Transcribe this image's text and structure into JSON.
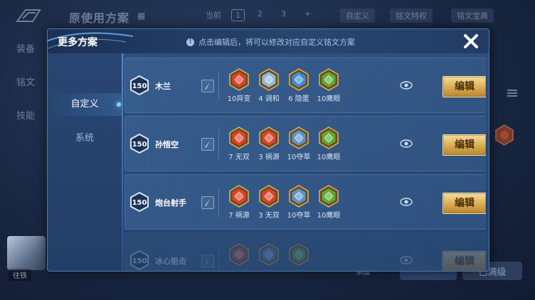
{
  "background": {
    "title": "原使用方案",
    "tab_current": "当前",
    "tabs": [
      "1",
      "2",
      "3",
      "+"
    ],
    "custom_chip": "自定义",
    "rune_special_chip": "铭文特权",
    "rune_dict_chip": "铭文宝典",
    "left_menu": [
      "装备",
      "铭文",
      "技能"
    ],
    "avatar_tag": "往铁",
    "bottom_buttons": [
      "已满级"
    ],
    "bottom_small": "添加"
  },
  "modal": {
    "title": "更多方案",
    "hint": "点击编辑后，将可以修改对应自定义铭文方案",
    "sidebar_tabs": [
      {
        "label": "自定义",
        "active": true
      },
      {
        "label": "系统",
        "active": false
      }
    ],
    "rows": [
      {
        "level": "150",
        "name": "木兰",
        "runes": [
          {
            "label": "10异变",
            "color": "#d9442a",
            "icon": "red-rune-icon"
          },
          {
            "label": "4 调和",
            "color": "#8fb8d8",
            "icon": "blue-rune-icon"
          },
          {
            "label": "6 隐匿",
            "color": "#3a8ed8",
            "icon": "blue-rune-icon"
          },
          {
            "label": "10鹰眼",
            "color": "#5fa832",
            "icon": "green-rune-icon"
          }
        ],
        "edit_label": "编辑"
      },
      {
        "level": "150",
        "name": "孙悟空",
        "runes": [
          {
            "label": "7 无双",
            "color": "#d9442a",
            "icon": "red-rune-icon"
          },
          {
            "label": "3 祸源",
            "color": "#d9442a",
            "icon": "red-rune-icon"
          },
          {
            "label": "10夺萃",
            "color": "#5b92c8",
            "icon": "blue-rune-icon"
          },
          {
            "label": "10鹰眼",
            "color": "#5fa832",
            "icon": "green-rune-icon"
          }
        ],
        "edit_label": "编辑"
      },
      {
        "level": "150",
        "name": "炮台射手",
        "runes": [
          {
            "label": "7 祸源",
            "color": "#d9442a",
            "icon": "red-rune-icon"
          },
          {
            "label": "3 无双",
            "color": "#d9442a",
            "icon": "red-rune-icon"
          },
          {
            "label": "10夺萃",
            "color": "#5b92c8",
            "icon": "blue-rune-icon"
          },
          {
            "label": "10鹰眼",
            "color": "#5fa832",
            "icon": "green-rune-icon"
          }
        ],
        "edit_label": "编辑"
      },
      {
        "level": "150",
        "name": "冰心狙击",
        "runes": [
          {
            "label": "",
            "color": "#d9442a",
            "icon": "red-rune-icon"
          },
          {
            "label": "",
            "color": "#5b92c8",
            "icon": "blue-rune-icon"
          },
          {
            "label": "",
            "color": "#5fa832",
            "icon": "green-rune-icon"
          }
        ],
        "edit_label": "编辑"
      }
    ]
  },
  "colors": {
    "accent_gold": "#d9ab52",
    "modal_bg": "#30527f",
    "text_primary": "#ffffff"
  }
}
